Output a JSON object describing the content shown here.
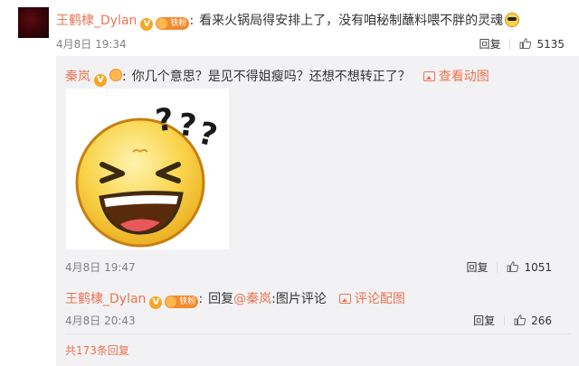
{
  "comment": {
    "author": "王鹤棣_Dylan",
    "verified_badge": "V",
    "fan_badge": "铁粉",
    "separator": ":",
    "text": "看来火锅局得安排上了，没有咱秘制蘸料喂不胖的灵魂",
    "emoji": "sunglasses-emoji",
    "time": "4月8日 19:34",
    "reply_label": "回复",
    "like_count": "5135"
  },
  "replies": [
    {
      "author": "秦岚",
      "verified_badge": "V",
      "separator": ":",
      "text": "你几个意思？是见不得姐瘦吗？还想不想转正了？",
      "view_animation_label": "查看动图",
      "time": "4月8日 19:47",
      "reply_label": "回复",
      "like_count": "1051"
    },
    {
      "author": "王鹤棣_Dylan",
      "verified_badge": "V",
      "fan_badge": "铁粉",
      "separator": ":",
      "reply_prefix": "回复",
      "mention": "@秦岚",
      "text": ":图片评论",
      "view_image_label": "评论配图",
      "time": "4月8日 20:43",
      "reply_label": "回复",
      "like_count": "266"
    }
  ],
  "more_replies_label": "共173条回复",
  "colors": {
    "link": "#eb7350",
    "panel_bg": "#f2f2f5",
    "muted": "#808080"
  }
}
